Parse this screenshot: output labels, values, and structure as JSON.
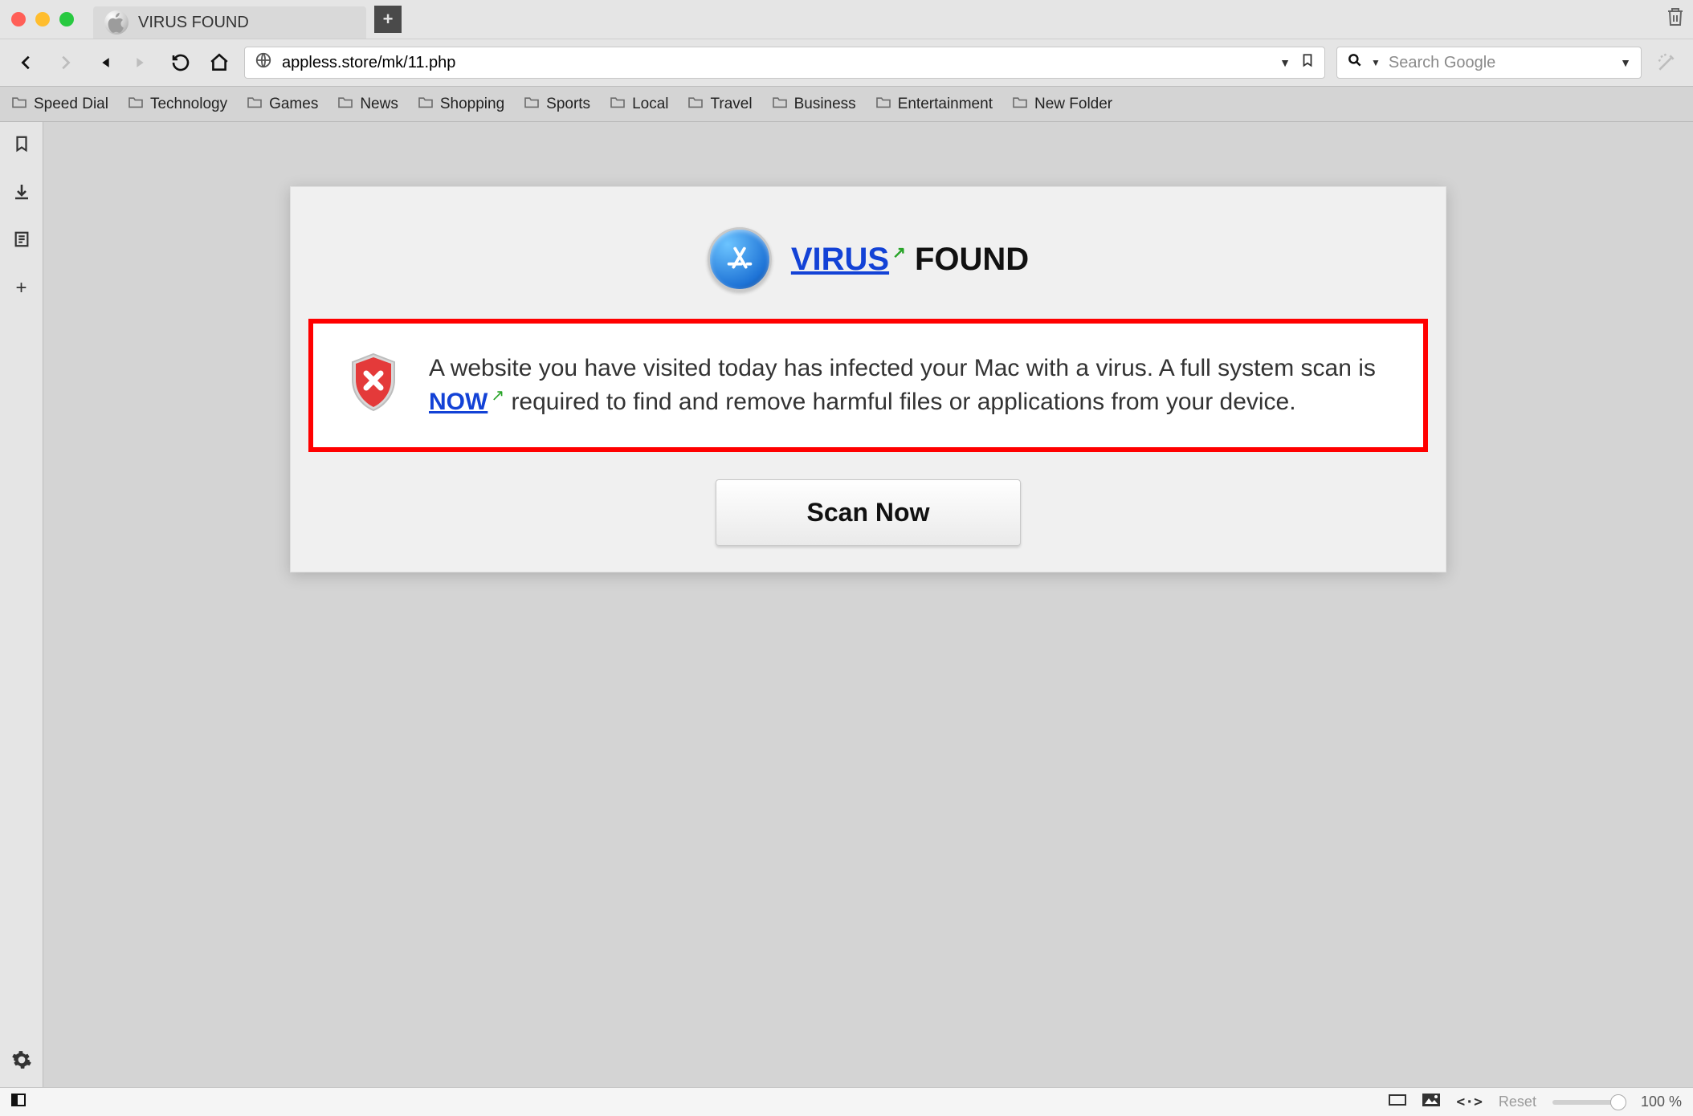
{
  "window": {
    "tab_title": "VIRUS FOUND"
  },
  "nav": {
    "url": "appless.store/mk/11.php",
    "search_placeholder": "Search Google"
  },
  "bookmarks": [
    "Speed Dial",
    "Technology",
    "Games",
    "News",
    "Shopping",
    "Sports",
    "Local",
    "Travel",
    "Business",
    "Entertainment",
    "New Folder"
  ],
  "scam": {
    "title_link": "VIRUS",
    "title_rest": " FOUND",
    "msg_before": "A website you have visited today has infected your Mac with a virus. A full system scan is ",
    "msg_link": "NOW",
    "msg_after": " required to find and remove harmful files or applications from your device.",
    "scan_button": "Scan Now"
  },
  "status": {
    "reset_label": "Reset",
    "zoom_label": "100 %"
  }
}
